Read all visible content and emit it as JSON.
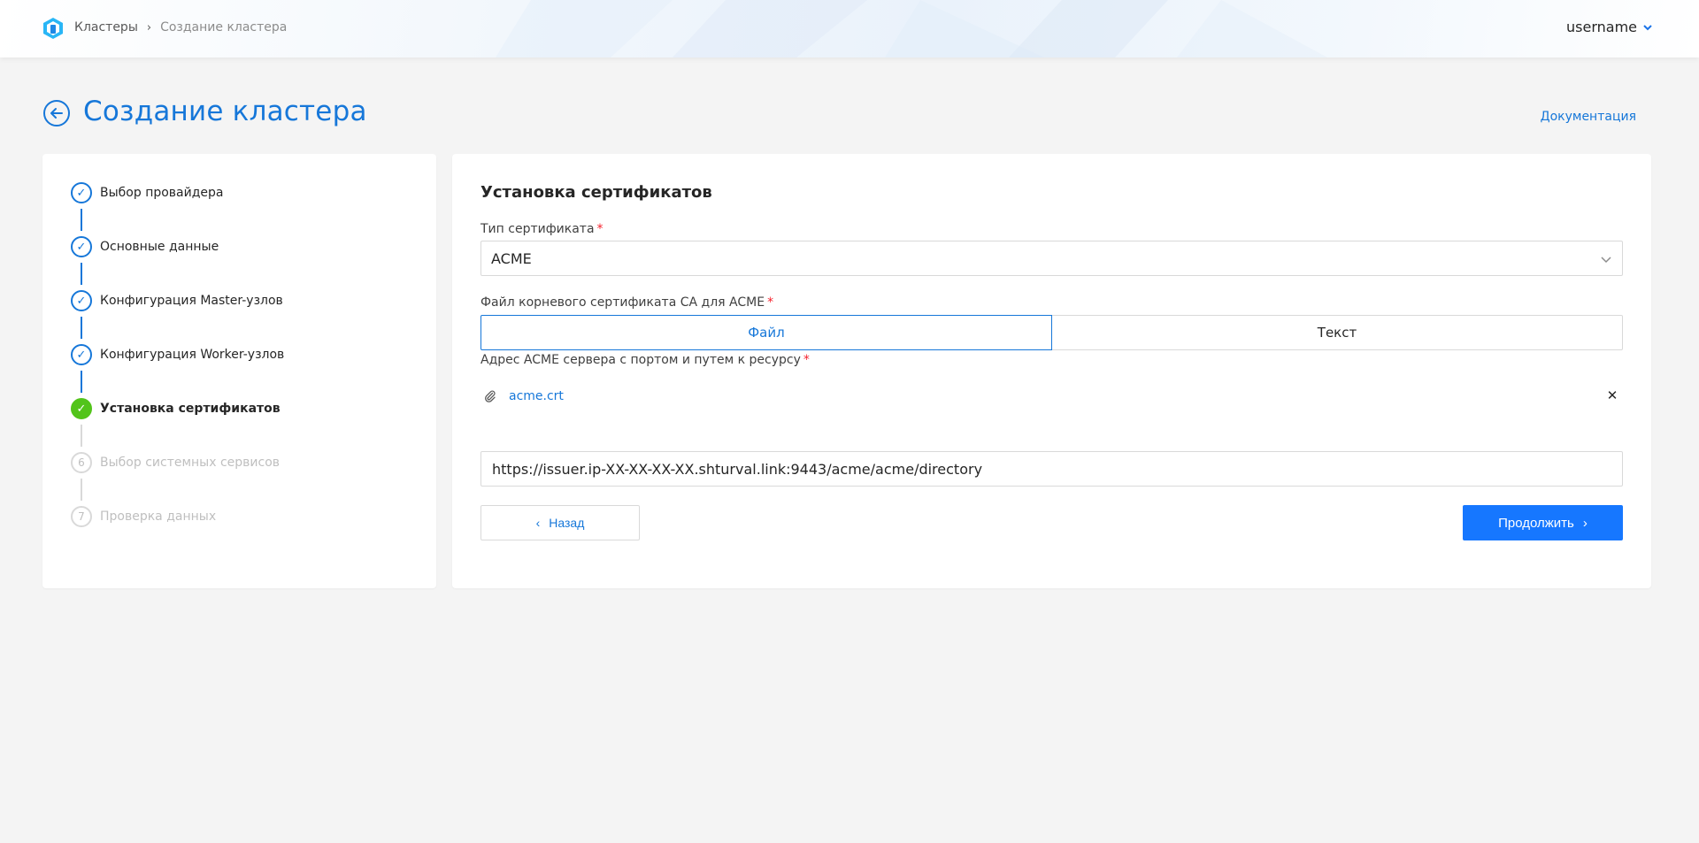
{
  "header": {
    "breadcrumb": [
      {
        "label": "Кластеры"
      },
      {
        "label": "Создание кластера"
      }
    ],
    "username": "username"
  },
  "page": {
    "title": "Создание кластера",
    "doc_link": "Документация"
  },
  "steps": [
    {
      "label": "Выбор провайдера",
      "status": "done"
    },
    {
      "label": "Основные данные",
      "status": "done"
    },
    {
      "label": "Конфигурация Master-узлов",
      "status": "done"
    },
    {
      "label": "Конфигурация Worker-узлов",
      "status": "done"
    },
    {
      "label": "Установка сертификатов",
      "status": "active"
    },
    {
      "label": "Выбор системных сервисов",
      "status": "todo",
      "number": "6"
    },
    {
      "label": "Проверка данных",
      "status": "todo",
      "number": "7"
    }
  ],
  "form": {
    "title": "Установка сертификатов",
    "cert_type_label": "Тип сертификата",
    "cert_type_value": "ACME",
    "root_cert_label": "Файл корневого сертификата CA для ACME",
    "tabs": [
      {
        "label": "Файл",
        "active": true
      },
      {
        "label": "Текст",
        "active": false
      }
    ],
    "file_name": "acme.crt",
    "acme_address_label": "Адрес ACME сервера с портом и путем к ресурсу",
    "acme_address_value": "https://issuer.ip-XX-XX-XX-XX.shturval.link:9443/acme/acme/directory",
    "back_label": "Назад",
    "next_label": "Продолжить",
    "required_mark": "*"
  },
  "colors": {
    "accent": "#1677d9",
    "primary_button": "#1677ff",
    "success": "#52c41a",
    "required": "#f5222d"
  }
}
